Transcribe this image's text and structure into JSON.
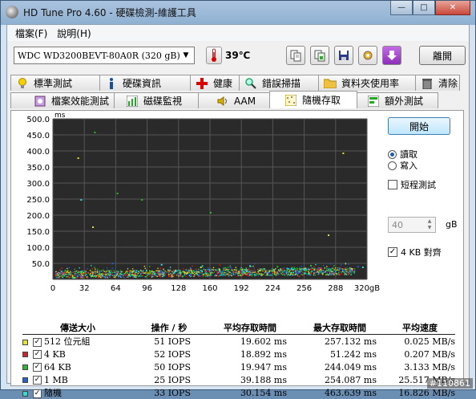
{
  "window": {
    "title": "HD Tune Pro 4.60 - 硬碟檢測-維護工具",
    "minimize_glyph": "—",
    "maximize_glyph": "□",
    "close_glyph": "✕"
  },
  "menu": [
    "檔案(F)",
    "說明(H)"
  ],
  "toolbar": {
    "drive": "WDC WD3200BEVT-80A0R     (320 gB)",
    "temperature": "39℃",
    "exit_label": "離開",
    "icons": [
      "copy-text-icon",
      "copy-screenshot-icon",
      "save-icon",
      "options-icon",
      "download-icon"
    ]
  },
  "tabs_top": [
    {
      "label": "標準測試",
      "icon": "bulb-icon"
    },
    {
      "label": "硬碟資訊",
      "icon": "info-icon"
    },
    {
      "label": "健康",
      "icon": "health-cross-icon"
    },
    {
      "label": "錯誤掃描",
      "icon": "magnifier-icon"
    },
    {
      "label": "資料夾使用率",
      "icon": "folder-icon"
    },
    {
      "label": "清除",
      "icon": "trash-icon"
    }
  ],
  "tabs_bottom": [
    {
      "label": "檔案效能測試",
      "icon": "file-benchmark-icon"
    },
    {
      "label": "磁碟監視",
      "icon": "disk-monitor-icon"
    },
    {
      "label": "AAM",
      "icon": "speaker-icon"
    },
    {
      "label": "隨機存取",
      "icon": "random-access-icon",
      "active": true
    },
    {
      "label": "額外測試",
      "icon": "extra-tests-icon"
    }
  ],
  "side": {
    "start_label": "開始",
    "read_label": "讀取",
    "write_label": "寫入",
    "mode": "read",
    "short_test_label": "短程測試",
    "short_test_checked": false,
    "short_size": "40",
    "short_unit": "gB",
    "align_label": "4 KB 對齊",
    "align_checked": true
  },
  "chart_data": {
    "type": "scatter",
    "ylabel": "ms",
    "xlim": [
      0,
      320
    ],
    "ylim": [
      0,
      500
    ],
    "xticks": [
      "0",
      "32",
      "64",
      "96",
      "128",
      "160",
      "192",
      "224",
      "256",
      "288",
      "320gB"
    ],
    "yticks": [
      "500.0",
      "450.0",
      "400.0",
      "350.0",
      "300.0",
      "250.0",
      "200.0",
      "150.0",
      "100.0",
      "50.0"
    ],
    "grid": true,
    "background": "#2a2a2a",
    "series": [
      {
        "name": "512 位元組",
        "color": "#e0e020",
        "points": [
          [
            40,
            165
          ],
          [
            25,
            380
          ],
          [
            280,
            140
          ],
          [
            295,
            395
          ],
          [
            150,
            40
          ],
          [
            210,
            30
          ]
        ]
      },
      {
        "name": "4 KB",
        "color": "#e02020",
        "points": [
          [
            120,
            20
          ],
          [
            250,
            12
          ],
          [
            300,
            18
          ]
        ]
      },
      {
        "name": "64 KB",
        "color": "#20c020",
        "points": [
          [
            42,
            460
          ],
          [
            65,
            270
          ],
          [
            90,
            250
          ],
          [
            160,
            210
          ],
          [
            175,
            38
          ],
          [
            228,
            42
          ],
          [
            262,
            45
          ]
        ]
      },
      {
        "name": "1 MB",
        "color": "#2060e0",
        "points": [
          [
            60,
            52
          ],
          [
            180,
            40
          ],
          [
            270,
            38
          ],
          [
            310,
            42
          ]
        ]
      },
      {
        "name": "隨機",
        "color": "#20e0e0",
        "points": [
          [
            28,
            250
          ],
          [
            110,
            48
          ],
          [
            200,
            44
          ],
          [
            315,
            40
          ]
        ]
      }
    ]
  },
  "results": {
    "headers": [
      "傳送大小",
      "操作 / 秒",
      "平均存取時間",
      "最大存取時間",
      "平均速度"
    ],
    "rows": [
      {
        "size": "512 位元組",
        "color": "#e8e820",
        "iops": "51 IOPS",
        "avg": "19.602 ms",
        "max": "257.132 ms",
        "speed": "0.025 MB/s"
      },
      {
        "size": "4 KB",
        "color": "#e02020",
        "iops": "52 IOPS",
        "avg": "18.892 ms",
        "max": "51.242 ms",
        "speed": "0.207 MB/s"
      },
      {
        "size": "64 KB",
        "color": "#20c020",
        "iops": "50 IOPS",
        "avg": "19.947 ms",
        "max": "244.049 ms",
        "speed": "3.133 MB/s"
      },
      {
        "size": "1 MB",
        "color": "#2060e0",
        "iops": "25 IOPS",
        "avg": "39.188 ms",
        "max": "254.087 ms",
        "speed": "25.517 MB/s"
      },
      {
        "size": "隨機",
        "color": "#20e0e0",
        "iops": "33 IOPS",
        "avg": "30.154 ms",
        "max": "463.639 ms",
        "speed": "16.826 MB/s"
      }
    ]
  },
  "watermark": "#110861"
}
